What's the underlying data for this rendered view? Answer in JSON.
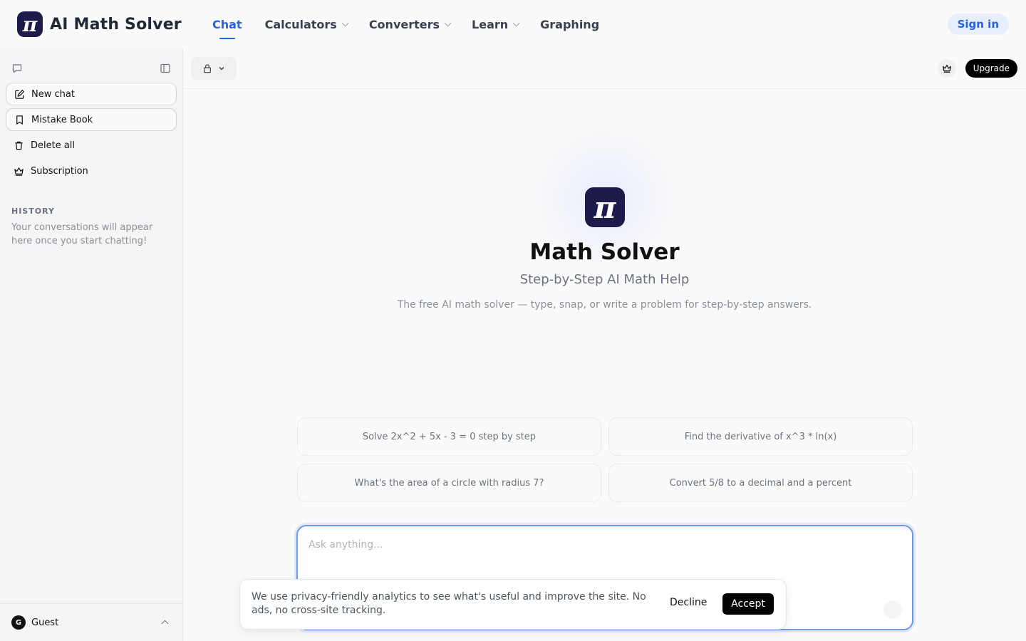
{
  "brand": {
    "logo_symbol": "π",
    "name": "AI Math Solver",
    "logo_color": "#1e1b4b"
  },
  "nav": {
    "items": [
      {
        "label": "Chat",
        "active": true,
        "dropdown": false
      },
      {
        "label": "Calculators",
        "active": false,
        "dropdown": true
      },
      {
        "label": "Converters",
        "active": false,
        "dropdown": true
      },
      {
        "label": "Learn",
        "active": false,
        "dropdown": true
      },
      {
        "label": "Graphing",
        "active": false,
        "dropdown": false
      }
    ],
    "signin_label": "Sign in",
    "accent": "#2563eb"
  },
  "sidebar": {
    "top_icons": [
      "chat-bubble-icon",
      "sidebar-toggle-icon"
    ],
    "items": [
      {
        "label": "New chat",
        "icon": "edit-icon"
      },
      {
        "label": "Mistake Book",
        "icon": "bookmark-icon"
      },
      {
        "label": "Delete all",
        "icon": "trash-icon"
      },
      {
        "label": "Subscription",
        "icon": "crown-icon"
      }
    ],
    "history_heading": "HISTORY",
    "history_empty": "Your conversations will appear here once you start chatting!",
    "user": {
      "avatar_letter": "G",
      "name": "Guest"
    }
  },
  "toolbar": {
    "upgrade_label": "Upgrade"
  },
  "hero": {
    "logo_symbol": "π",
    "title": "Math Solver",
    "subtitle": "Step-by-Step AI Math Help",
    "description": "The free AI math solver — type, snap, or write a problem for step-by-step answers."
  },
  "suggestions": [
    "Solve 2x^2 + 5x - 3 = 0 step by step",
    "Find the derivative of x^3 * ln(x)",
    "What's the area of a circle with radius 7?",
    "Convert 5/8 to a decimal and a percent"
  ],
  "composer": {
    "placeholder": "Ask anything..."
  },
  "cookie": {
    "text": "We use privacy-friendly analytics to see what's useful and improve the site. No ads, no cross-site tracking.",
    "decline_label": "Decline",
    "accept_label": "Accept"
  }
}
